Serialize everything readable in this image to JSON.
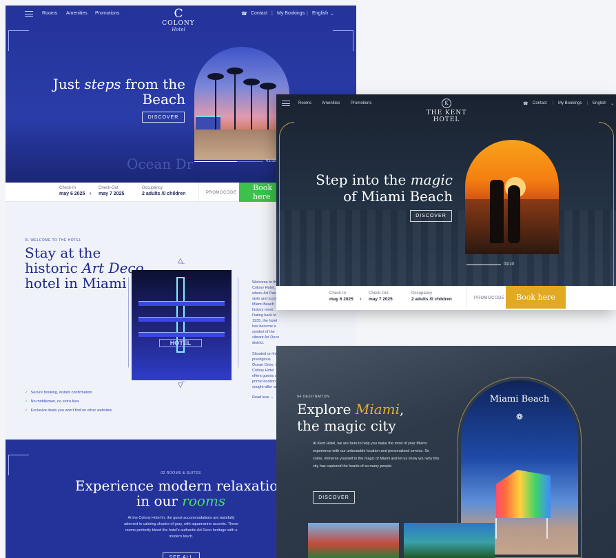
{
  "colony": {
    "nav": {
      "rooms": "Rooms",
      "amenities": "Amenities",
      "promotions": "Promotions",
      "contact": "Contact",
      "bookings": "My Bookings",
      "language": "English"
    },
    "logo": {
      "letter": "C",
      "name": "COLONY",
      "script": "Hotel"
    },
    "hero": {
      "title_line1_pre": "Just ",
      "title_line1_em": "steps",
      "title_line1_post": " from the",
      "title_line2": "Beach",
      "cta": "DISCOVER",
      "slide_counter": "01/10",
      "overlay_text": "Ocean Dr"
    },
    "booking": {
      "checkin_label": "Check-In",
      "checkin_value": "may 6 2025",
      "checkout_label": "Check-Out",
      "checkout_value": "may 7 2025",
      "occupancy_label": "Occupancy",
      "occupancy_value": "2 adults /0 children",
      "promo": "PROMOCODE",
      "cta": "Book here"
    },
    "about": {
      "kicker": "01 WELCOME TO THE HOTEL",
      "title_line1": "Stay at the",
      "title_line2_pre": "historic ",
      "title_line2_em": "Art Deco",
      "title_line3": "hotel in Miami",
      "sign": "HOTEL",
      "paragraph1": "Welcome to the Colony Hotel, where Art Deco style and iconic Miami Beach history meet. Dating back to 1935, the hotel has become a symbol of the vibrant Art Deco district.",
      "paragraph2": "Situated on the prestigious Ocean Drive, the Colony Hotel offers guests a prime location in sought-after area as we take care of where hospitality is perfected for you.",
      "read_more": "Read less →",
      "checks": [
        "Secure booking, instant confirmation",
        "No middlemen, no extra fees",
        "Exclusive deals you won't find on other websites"
      ]
    },
    "rooms": {
      "kicker": "02 ROOMS & SUITES",
      "title_line1": "Experience modern relaxation",
      "title_line2_pre": "in our ",
      "title_line2_em": "rooms",
      "paragraph": "At the Colony Hotel In, the guest accommodations are tastefully adorned in calming shades of gray, with aquamarine accents. These rooms perfectly blend the hotel's authentic Art Deco heritage with a modern touch.",
      "cta": "SEE ALL"
    }
  },
  "kent": {
    "nav": {
      "rooms": "Rooms",
      "amenities": "Amenities",
      "promotions": "Promotions",
      "contact": "Contact",
      "bookings": "My Bookings",
      "language": "English"
    },
    "logo": {
      "letter": "K",
      "name": "THE KENT HOTEL"
    },
    "hero": {
      "title_line1_pre": "Step into the ",
      "title_line1_em": "magic",
      "title_line2": "of Miami Beach",
      "cta": "DISCOVER",
      "slide_counter": "01/10"
    },
    "booking": {
      "checkin_label": "Check-In",
      "checkin_value": "may 6 2025",
      "checkout_label": "Check-Out",
      "checkout_value": "may 7 2025",
      "occupancy_label": "Occupancy",
      "occupancy_value": "2 adults /0 children",
      "promo": "PROMOCODE",
      "cta": "Book here"
    },
    "destination": {
      "kicker": "04 DESTINATION",
      "title_line1_pre": "Explore ",
      "title_line1_em": "Miami",
      "title_line1_post": ",",
      "title_line2": "the magic city",
      "paragraph": "At Kent Hotel, we are here to help you make the most of your Miami experience with our unbeatable location and personalized service. So come, immerse yourself in the magic of Miami and let us show you why this city has captured the hearts of so many people.",
      "cta": "DISCOVER",
      "arch_title": "Miami Beach"
    }
  },
  "colors": {
    "colony_blue": "#24339a",
    "colony_green": "#3cc14a",
    "kent_dark": "#1b2433",
    "kent_gold": "#e2a922"
  }
}
